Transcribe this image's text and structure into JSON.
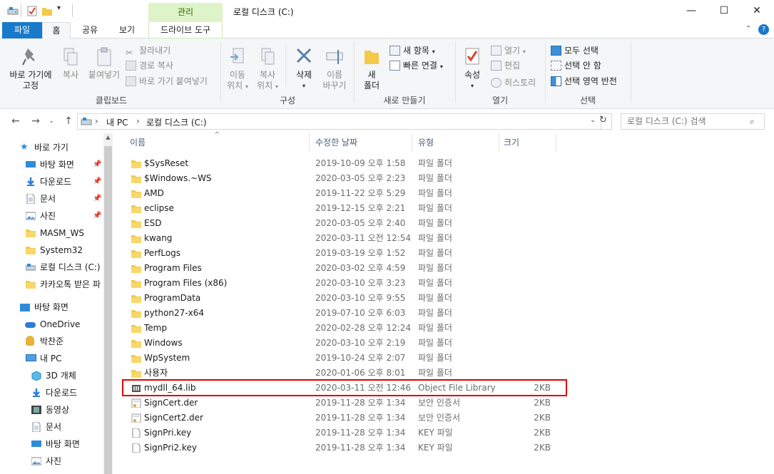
{
  "window": {
    "title": "로컬 디스크 (C:)",
    "context_tab_group": "관리",
    "minimize": "—",
    "maximize": "☐",
    "close": "✕"
  },
  "tabs": [
    {
      "label": "파일"
    },
    {
      "label": "홈"
    },
    {
      "label": "공유"
    },
    {
      "label": "보기"
    },
    {
      "label": "드라이브 도구"
    }
  ],
  "ribbon": {
    "clipboard": {
      "pin_quick_line1": "바로 가기에",
      "pin_quick_line2": "고정",
      "copy": "복사",
      "paste": "붙여넣기",
      "cut": "잘라내기",
      "copy_path": "경로 복사",
      "paste_shortcut": "바로 가기 붙여넣기",
      "label": "클립보드"
    },
    "organize": {
      "move_to_line1": "이동",
      "move_to_line2": "위치",
      "copy_to_line1": "복사",
      "copy_to_line2": "위치",
      "delete": "삭제",
      "rename_line1": "이름",
      "rename_line2": "바꾸기",
      "label": "구성"
    },
    "new": {
      "new_folder_line1": "새",
      "new_folder_line2": "폴더",
      "new_item": "새 항목",
      "easy_access": "빠른 연결",
      "label": "새로 만들기"
    },
    "open": {
      "properties": "속성",
      "open": "열기",
      "edit": "편집",
      "history": "히스토리",
      "label": "열기"
    },
    "select": {
      "select_all": "모두 선택",
      "select_none": "선택 안 함",
      "invert": "선택 영역 반전",
      "label": "선택"
    }
  },
  "address": {
    "segments": [
      "내 PC",
      "로컬 디스크 (C:)"
    ],
    "separator": "›",
    "search_placeholder": "로컬 디스크 (C:) 검색"
  },
  "nav": {
    "quick_access": "바로 가기",
    "items": [
      {
        "label": "바탕 화면",
        "icon": "desktop-icon",
        "pinned": true
      },
      {
        "label": "다운로드",
        "icon": "download-icon",
        "pinned": true
      },
      {
        "label": "문서",
        "icon": "document-icon",
        "pinned": true
      },
      {
        "label": "사진",
        "icon": "pictures-icon",
        "pinned": true
      },
      {
        "label": "MASM_WS",
        "icon": "folder-icon",
        "pinned": false
      },
      {
        "label": "System32",
        "icon": "folder-icon",
        "pinned": false
      },
      {
        "label": "로컬 디스크 (C:)",
        "icon": "drive-icon",
        "pinned": false
      },
      {
        "label": "카카오톡 받은 파",
        "icon": "folder-icon",
        "pinned": false
      }
    ],
    "desktop": "바탕 화면",
    "onedrive": "OneDrive",
    "user": "박찬준",
    "this_pc": "내 PC",
    "pc_items": [
      {
        "label": "3D 개체",
        "icon": "3d-objects-icon"
      },
      {
        "label": "다운로드",
        "icon": "download-icon"
      },
      {
        "label": "동영상",
        "icon": "videos-icon"
      },
      {
        "label": "문서",
        "icon": "document-icon"
      },
      {
        "label": "바탕 화면",
        "icon": "desktop-icon"
      },
      {
        "label": "사진",
        "icon": "pictures-icon"
      }
    ]
  },
  "columns": {
    "name": "이름",
    "date": "수정한 날짜",
    "type": "유형",
    "size": "크기"
  },
  "files": [
    {
      "name": "$SysReset",
      "date": "2019-10-09 오후 1:58",
      "type": "파일 폴더",
      "size": "",
      "icon": "folder-icon"
    },
    {
      "name": "$Windows.~WS",
      "date": "2020-03-05 오후 2:23",
      "type": "파일 폴더",
      "size": "",
      "icon": "folder-icon"
    },
    {
      "name": "AMD",
      "date": "2019-11-22 오후 5:29",
      "type": "파일 폴더",
      "size": "",
      "icon": "folder-icon"
    },
    {
      "name": "eclipse",
      "date": "2019-12-15 오후 2:21",
      "type": "파일 폴더",
      "size": "",
      "icon": "folder-icon"
    },
    {
      "name": "ESD",
      "date": "2020-03-05 오후 2:40",
      "type": "파일 폴더",
      "size": "",
      "icon": "folder-icon"
    },
    {
      "name": "kwang",
      "date": "2020-03-11 오전 12:54",
      "type": "파일 폴더",
      "size": "",
      "icon": "folder-icon"
    },
    {
      "name": "PerfLogs",
      "date": "2019-03-19 오후 1:52",
      "type": "파일 폴더",
      "size": "",
      "icon": "folder-icon"
    },
    {
      "name": "Program Files",
      "date": "2020-03-02 오후 4:59",
      "type": "파일 폴더",
      "size": "",
      "icon": "folder-icon"
    },
    {
      "name": "Program Files (x86)",
      "date": "2020-03-10 오후 3:23",
      "type": "파일 폴더",
      "size": "",
      "icon": "folder-icon"
    },
    {
      "name": "ProgramData",
      "date": "2020-03-10 오후 9:55",
      "type": "파일 폴더",
      "size": "",
      "icon": "folder-icon"
    },
    {
      "name": "python27-x64",
      "date": "2019-07-10 오후 6:03",
      "type": "파일 폴더",
      "size": "",
      "icon": "folder-icon"
    },
    {
      "name": "Temp",
      "date": "2020-02-28 오후 12:24",
      "type": "파일 폴더",
      "size": "",
      "icon": "folder-icon"
    },
    {
      "name": "Windows",
      "date": "2020-03-10 오후 2:19",
      "type": "파일 폴더",
      "size": "",
      "icon": "folder-icon"
    },
    {
      "name": "WpSystem",
      "date": "2019-10-24 오후 2:07",
      "type": "파일 폴더",
      "size": "",
      "icon": "folder-icon"
    },
    {
      "name": "사용자",
      "date": "2020-01-06 오후 8:01",
      "type": "파일 폴더",
      "size": "",
      "icon": "folder-icon"
    },
    {
      "name": "mydll_64.lib",
      "date": "2020-03-11 오전 12:46",
      "type": "Object File Library",
      "size": "2KB",
      "icon": "library-file-icon"
    },
    {
      "name": "SignCert.der",
      "date": "2019-11-28 오후 1:34",
      "type": "보안 인증서",
      "size": "2KB",
      "icon": "certificate-icon"
    },
    {
      "name": "SignCert2.der",
      "date": "2019-11-28 오후 1:34",
      "type": "보안 인증서",
      "size": "2KB",
      "icon": "certificate-icon"
    },
    {
      "name": "SignPri.key",
      "date": "2019-11-28 오후 1:34",
      "type": "KEY 파일",
      "size": "2KB",
      "icon": "blank-file-icon"
    },
    {
      "name": "SignPri2.key",
      "date": "2019-11-28 오후 1:34",
      "type": "KEY 파일",
      "size": "2KB",
      "icon": "blank-file-icon"
    }
  ],
  "colors": {
    "file_tab": "#1979ca",
    "context_tab": "#dff3c8",
    "folder": "#f3c94a",
    "highlight": "#e00000",
    "header_text": "#4c607a"
  }
}
